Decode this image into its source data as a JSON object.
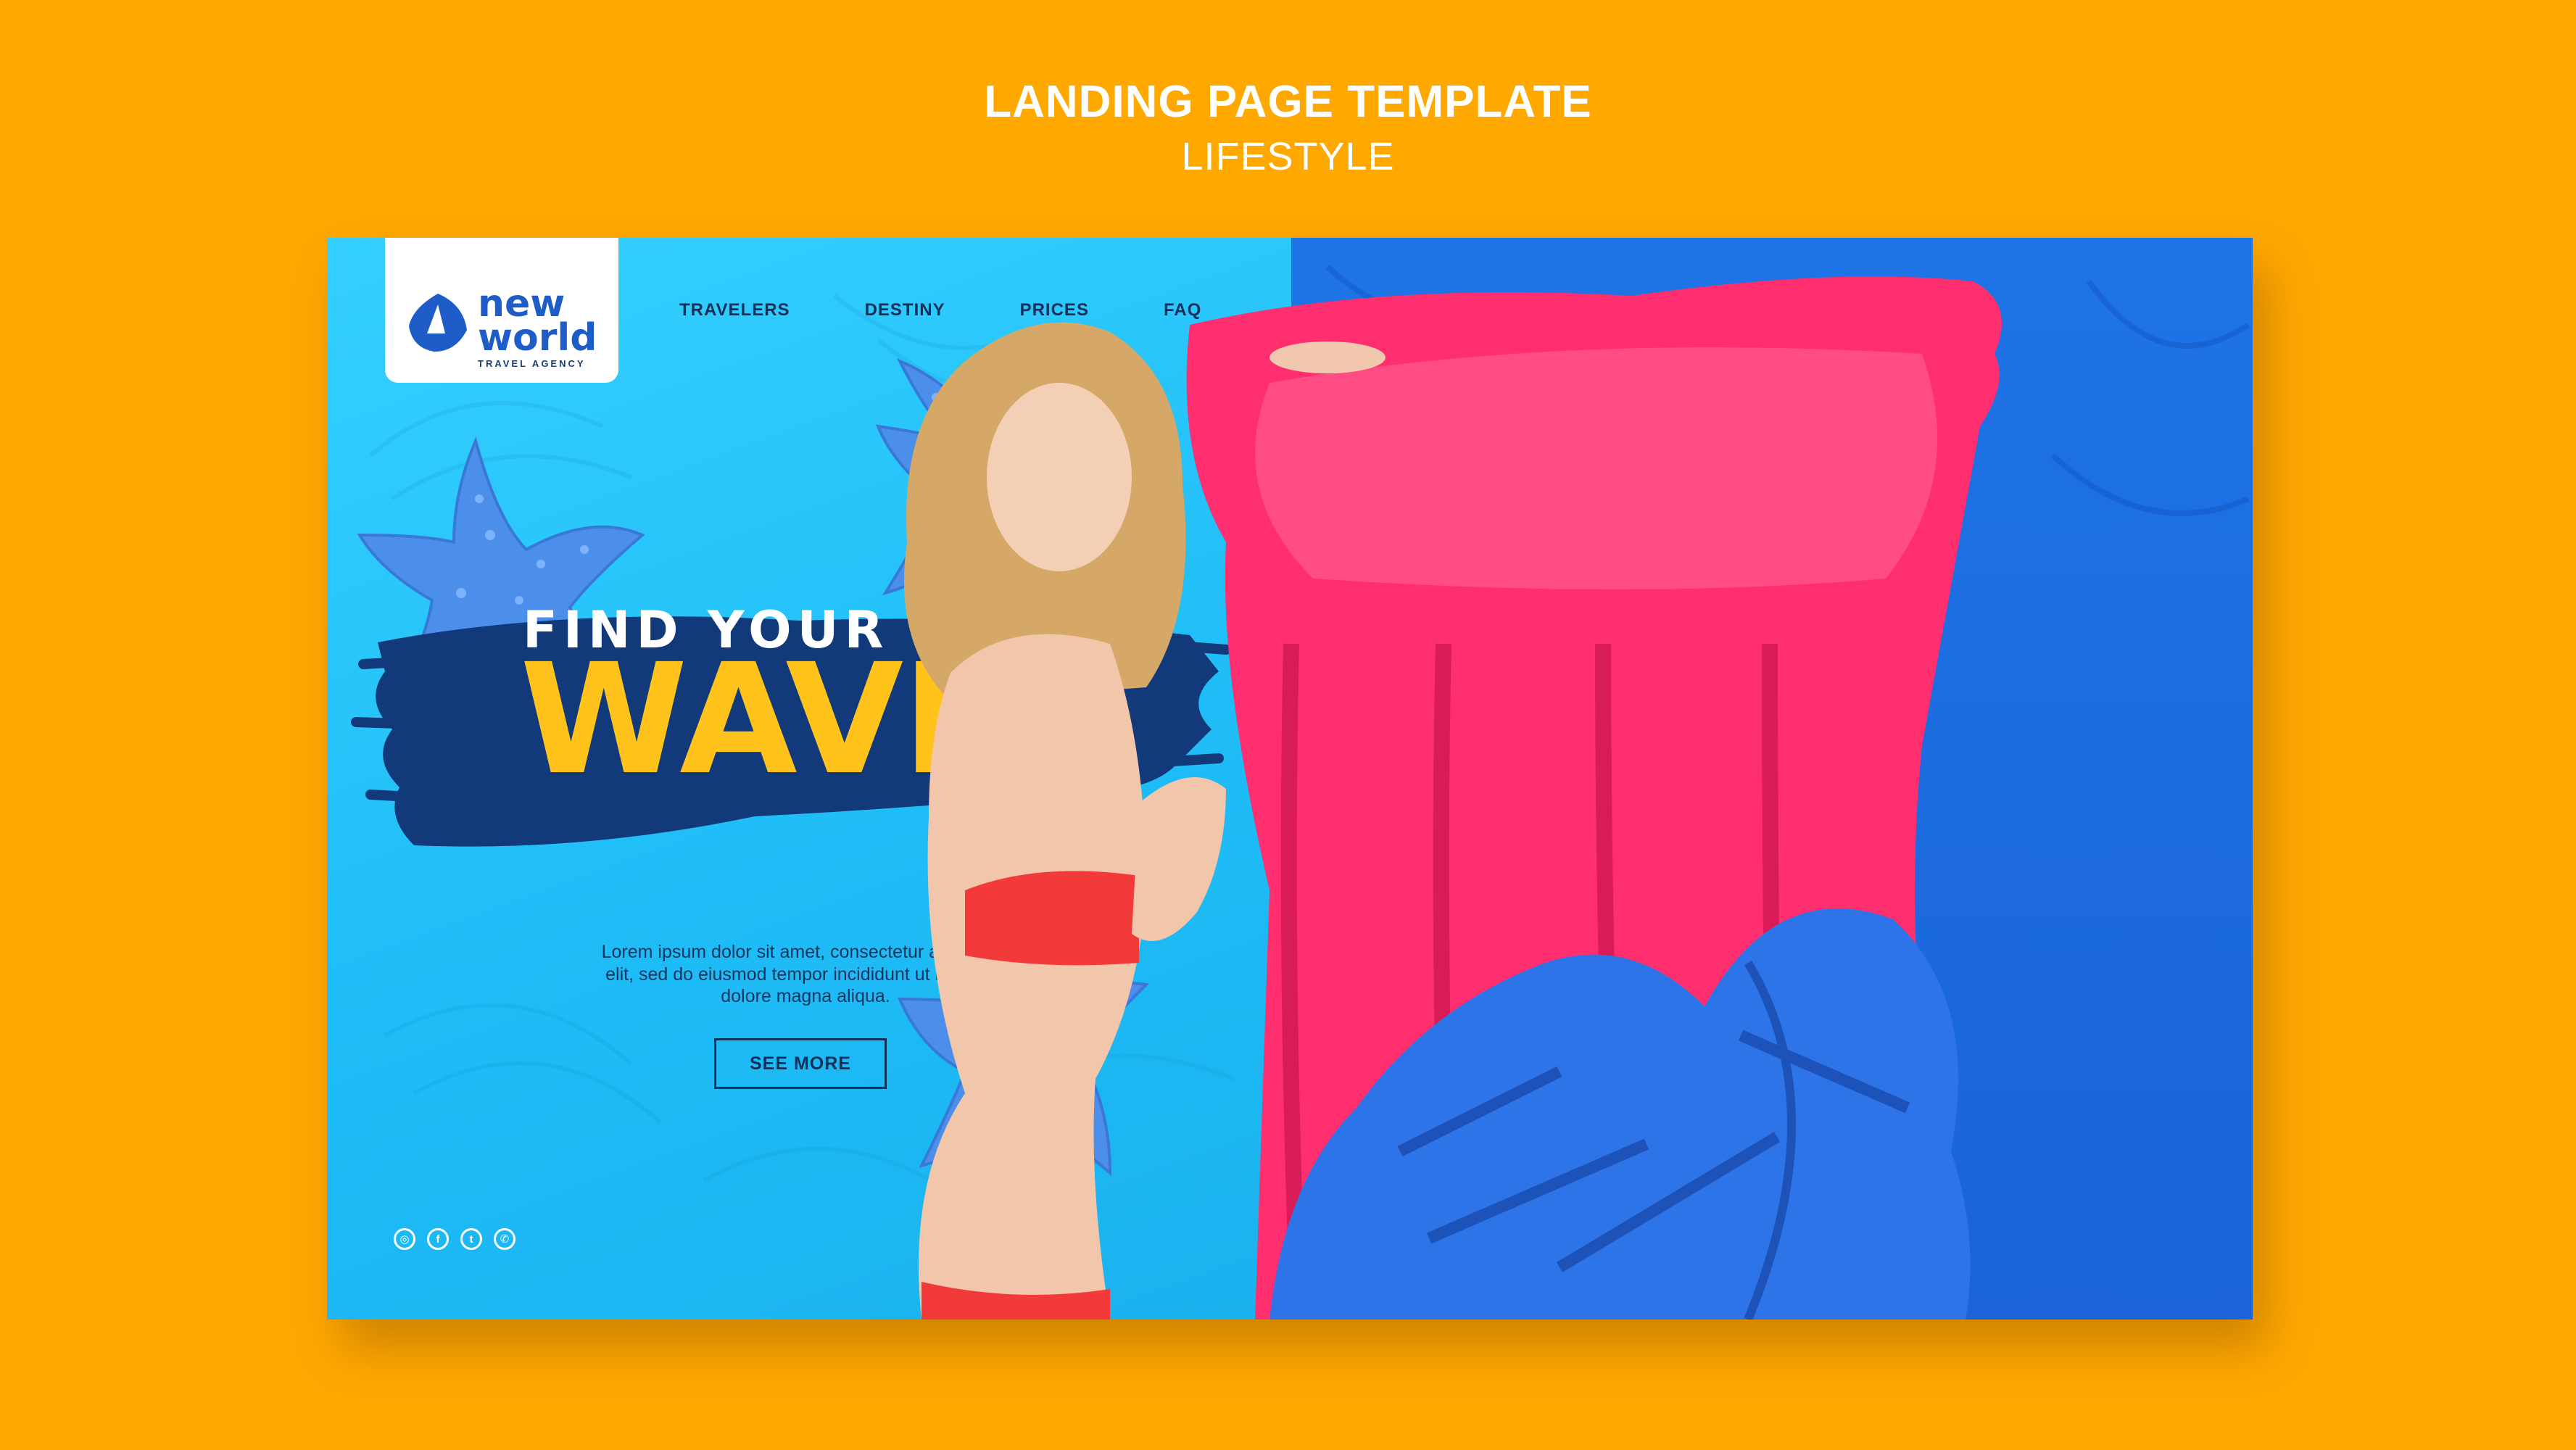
{
  "heading": {
    "title": "LANDING PAGE TEMPLATE",
    "subtitle": "LIFESTYLE"
  },
  "logo": {
    "line1": "new",
    "line2": "world",
    "line3": "TRAVEL AGENCY"
  },
  "nav": {
    "items": [
      {
        "label": "TRAVELERS"
      },
      {
        "label": "DESTINY"
      },
      {
        "label": "PRICES"
      },
      {
        "label": "FAQ"
      }
    ]
  },
  "hero": {
    "headline_small": "FIND YOUR",
    "headline_big": "WAVE",
    "body": "Lorem ipsum dolor sit amet, consectetur adipiscing elit, sed do eiusmod tempor incididunt ut labore et dolore magna aliqua.",
    "cta_label": "SEE MORE"
  },
  "socials": {
    "items": [
      {
        "icon": "instagram-icon",
        "glyph": "◎"
      },
      {
        "icon": "facebook-icon",
        "glyph": "f"
      },
      {
        "icon": "twitter-icon",
        "glyph": "t"
      },
      {
        "icon": "whatsapp-icon",
        "glyph": "✆"
      }
    ]
  },
  "colors": {
    "background": "#FFA800",
    "left_panel": "#25C4FA",
    "right_panel": "#1E6EE2",
    "navy": "#12305A",
    "accent_yellow": "#FFC31C",
    "float_pink": "#FF2E6E",
    "swimsuit_red": "#F23A3A"
  }
}
